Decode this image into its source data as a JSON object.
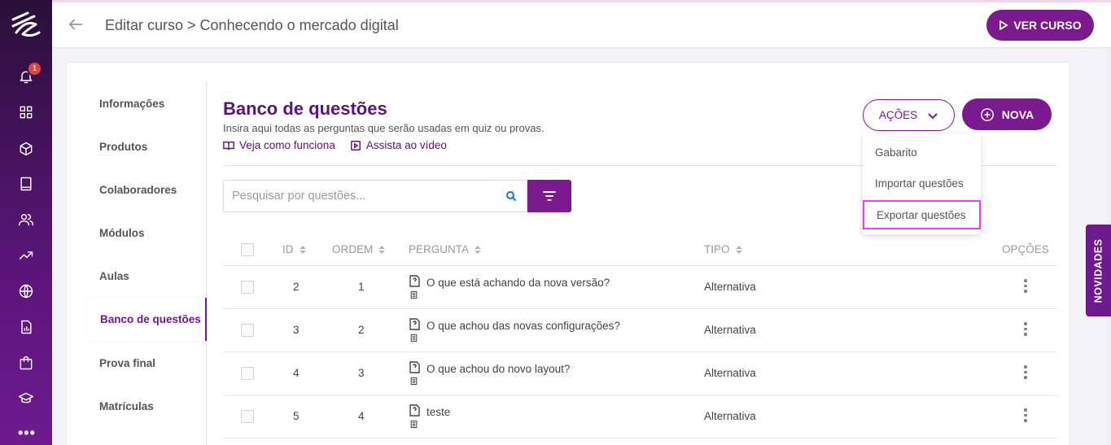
{
  "header": {
    "breadcrumb": "Editar curso > Conhecendo o mercado digital",
    "view_course_label": "VER CURSO"
  },
  "rail": {
    "notification_count": "1",
    "icons": [
      "logo-icon",
      "bell-icon",
      "grid-icon",
      "cube-icon",
      "book-icon",
      "users-icon",
      "trending-icon",
      "globe-icon",
      "report-icon",
      "shopping-bag-icon",
      "graduation-cap-icon",
      "more-icon"
    ]
  },
  "subnav": {
    "items": [
      {
        "label": "Informações"
      },
      {
        "label": "Produtos"
      },
      {
        "label": "Colaboradores"
      },
      {
        "label": "Módulos"
      },
      {
        "label": "Aulas"
      },
      {
        "label": "Banco de questões"
      },
      {
        "label": "Prova final"
      },
      {
        "label": "Matrículas"
      }
    ],
    "active_index": 5
  },
  "page": {
    "title": "Banco de questões",
    "description": "Insira aqui todas as perguntas que serão usadas em quiz ou provas.",
    "link_how": "Veja como funciona",
    "link_video": "Assista ao vídeo",
    "actions_label": "AÇÕES",
    "new_label": "NOVA"
  },
  "search": {
    "placeholder": "Pesquisar por questões...",
    "value": ""
  },
  "actions_menu": {
    "items": [
      "Gabarito",
      "Importar questões",
      "Exportar questões"
    ],
    "highlighted_index": 2
  },
  "table": {
    "columns": [
      "ID",
      "ORDEM",
      "PERGUNTA",
      "TIPO",
      "OPÇÕES"
    ],
    "rows": [
      {
        "id": "2",
        "order": "1",
        "question": "O que está achando da nova versão?",
        "type": "Alternativa"
      },
      {
        "id": "3",
        "order": "2",
        "question": "O que achou das novas configurações?",
        "type": "Alternativa"
      },
      {
        "id": "4",
        "order": "3",
        "question": "O que achou do novo layout?",
        "type": "Alternativa"
      },
      {
        "id": "5",
        "order": "4",
        "question": "teste",
        "type": "Alternativa"
      }
    ]
  },
  "side_tab": {
    "label": "NOVIDADES"
  },
  "colors": {
    "primary": "#7b1a8f",
    "title": "#5a1579",
    "highlight": "#ee3ef0",
    "badge": "#e8413a"
  }
}
